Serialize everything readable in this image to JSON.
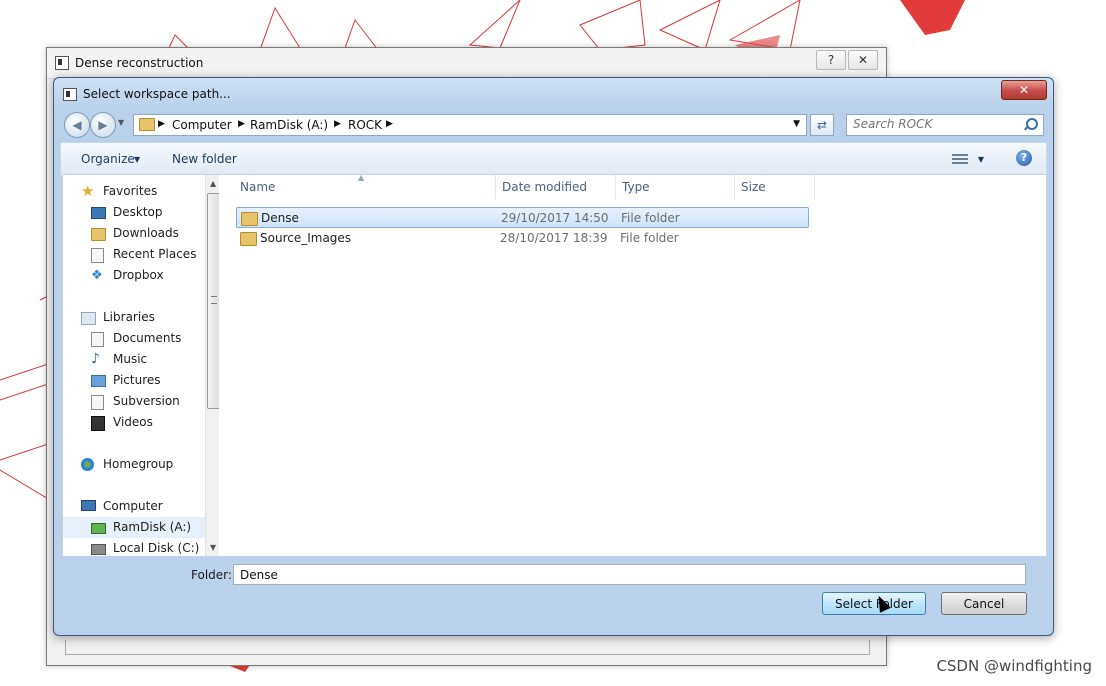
{
  "back_window": {
    "title": "Dense reconstruction",
    "help_button": "?",
    "close_button": "✕"
  },
  "dialog": {
    "title": "Select workspace path...",
    "close_button": "✕"
  },
  "address_bar": {
    "crumbs": [
      "Computer",
      "RamDisk (A:)",
      "ROCK"
    ]
  },
  "search": {
    "placeholder": "Search ROCK"
  },
  "toolbar": {
    "organize": "Organize",
    "new_folder": "New folder",
    "help": "?"
  },
  "nav": {
    "favorites": "Favorites",
    "desktop": "Desktop",
    "downloads": "Downloads",
    "recent": "Recent Places",
    "dropbox": "Dropbox",
    "libraries": "Libraries",
    "documents": "Documents",
    "music": "Music",
    "pictures": "Pictures",
    "subversion": "Subversion",
    "videos": "Videos",
    "homegroup": "Homegroup",
    "computer": "Computer",
    "ramdisk": "RamDisk (A:)",
    "localdisk": "Local Disk (C:)"
  },
  "columns": {
    "name": "Name",
    "date": "Date modified",
    "type": "Type",
    "size": "Size"
  },
  "files": [
    {
      "name": "Dense",
      "date": "29/10/2017 14:50",
      "type": "File folder"
    },
    {
      "name": "Source_Images",
      "date": "28/10/2017 18:39",
      "type": "File folder"
    }
  ],
  "folder": {
    "label": "Folder:",
    "value": "Dense"
  },
  "buttons": {
    "select": "Select Folder",
    "cancel": "Cancel"
  },
  "watermark": "CSDN @windfighting",
  "colors": {
    "accent": "#3c7fb1",
    "selection": "#cfe3fb",
    "background_shapes": "#e03b3b"
  }
}
